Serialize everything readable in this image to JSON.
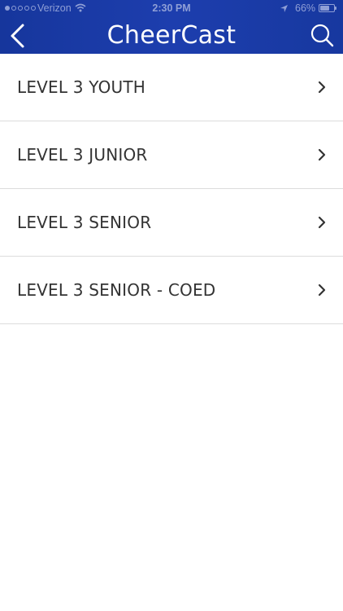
{
  "status_bar": {
    "carrier": "Verizon",
    "time": "2:30 PM",
    "battery_percent_text": "66%",
    "battery_level": 0.66,
    "signal_bars_filled": 1,
    "signal_bars_total": 5
  },
  "header": {
    "title": "CheerCast",
    "back_icon": "chevron-left-icon",
    "search_icon": "search-icon",
    "background_color": "#1a3aa6"
  },
  "list": {
    "items": [
      {
        "label": "LEVEL 3 YOUTH"
      },
      {
        "label": "LEVEL 3 JUNIOR"
      },
      {
        "label": "LEVEL 3 SENIOR"
      },
      {
        "label": "LEVEL 3 SENIOR - COED"
      }
    ],
    "item_icon": "chevron-right-icon"
  }
}
